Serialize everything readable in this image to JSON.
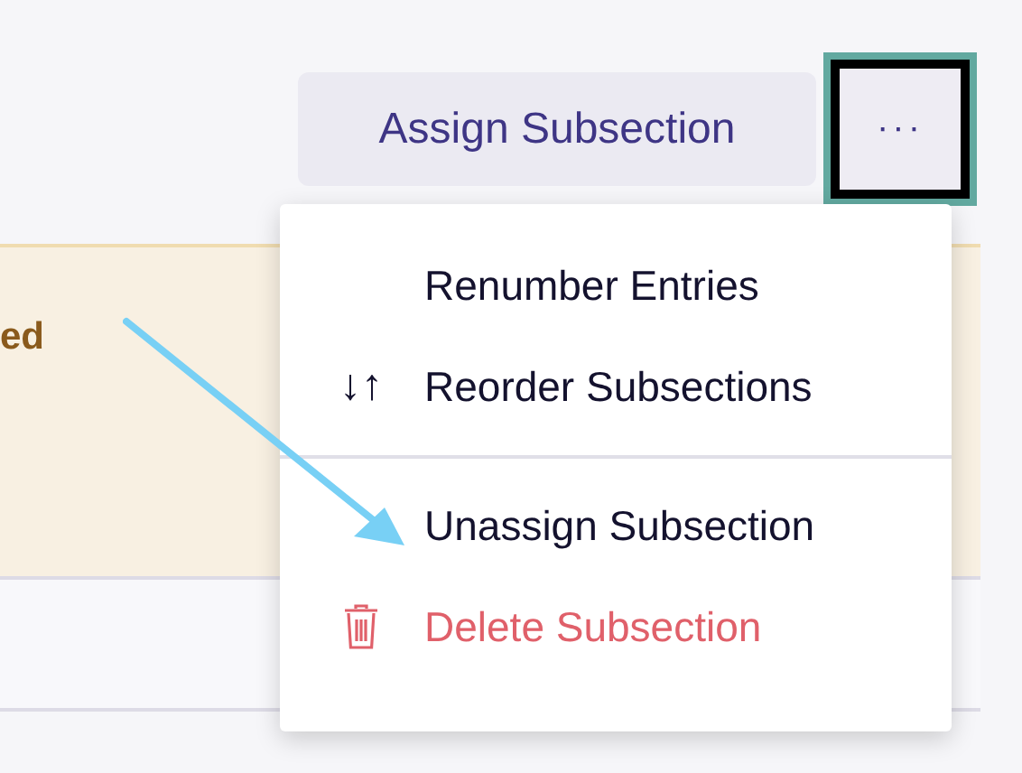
{
  "toolbar": {
    "assign_button": "Assign Subsection",
    "more_button": {
      "label": "···",
      "focused": true
    }
  },
  "notice": {
    "text": "ed"
  },
  "menu": {
    "items": [
      {
        "kind": "plain",
        "label": "Renumber Entries"
      },
      {
        "kind": "reorder",
        "label": "Reorder Subsections",
        "icon": "↓↑"
      },
      {
        "kind": "separator"
      },
      {
        "kind": "plain",
        "label": "Unassign Subsection"
      },
      {
        "kind": "danger",
        "label": "Delete Subsection"
      }
    ]
  },
  "annotation": {
    "kind": "arrow"
  }
}
